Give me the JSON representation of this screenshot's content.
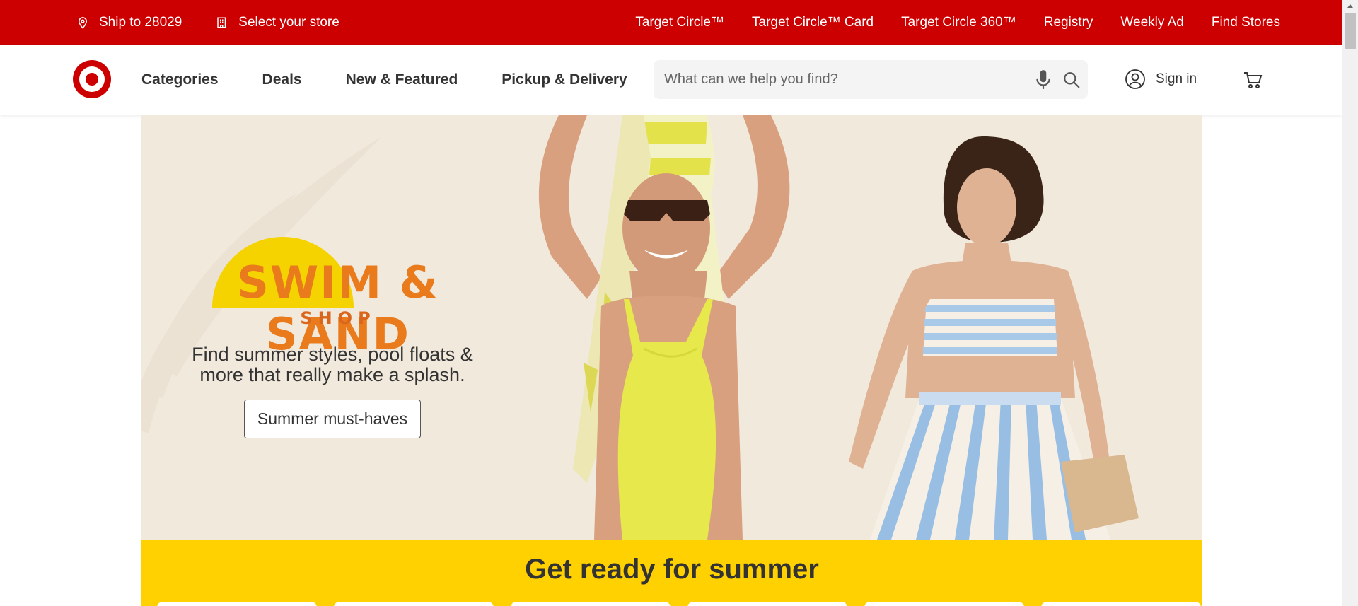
{
  "utility": {
    "ship_to": "Ship to 28029",
    "store": "Select your store",
    "links": [
      "Target Circle™",
      "Target Circle™ Card",
      "Target Circle 360™",
      "Registry",
      "Weekly Ad",
      "Find Stores"
    ]
  },
  "nav": {
    "categories": "Categories",
    "deals": "Deals",
    "new_featured": "New & Featured",
    "pickup_delivery": "Pickup & Delivery"
  },
  "search": {
    "placeholder": "What can we help you find?"
  },
  "account": {
    "sign_in": "Sign in"
  },
  "hero": {
    "logo_line1": "SWIM & SAND",
    "logo_line2": "SHOP",
    "subtitle": "Find summer styles, pool floats & more that really make a splash.",
    "button": "Summer must-haves"
  },
  "summer": {
    "title": "Get ready for summer"
  },
  "colors": {
    "brand_red": "#cc0000",
    "summer_yellow": "#ffd100",
    "hero_bg": "#f2e9dd",
    "logo_orange": "#ea7b1c"
  },
  "icons": [
    "location-pin-icon",
    "store-icon",
    "target-logo",
    "microphone-icon",
    "search-icon",
    "user-circle-icon",
    "cart-icon"
  ]
}
